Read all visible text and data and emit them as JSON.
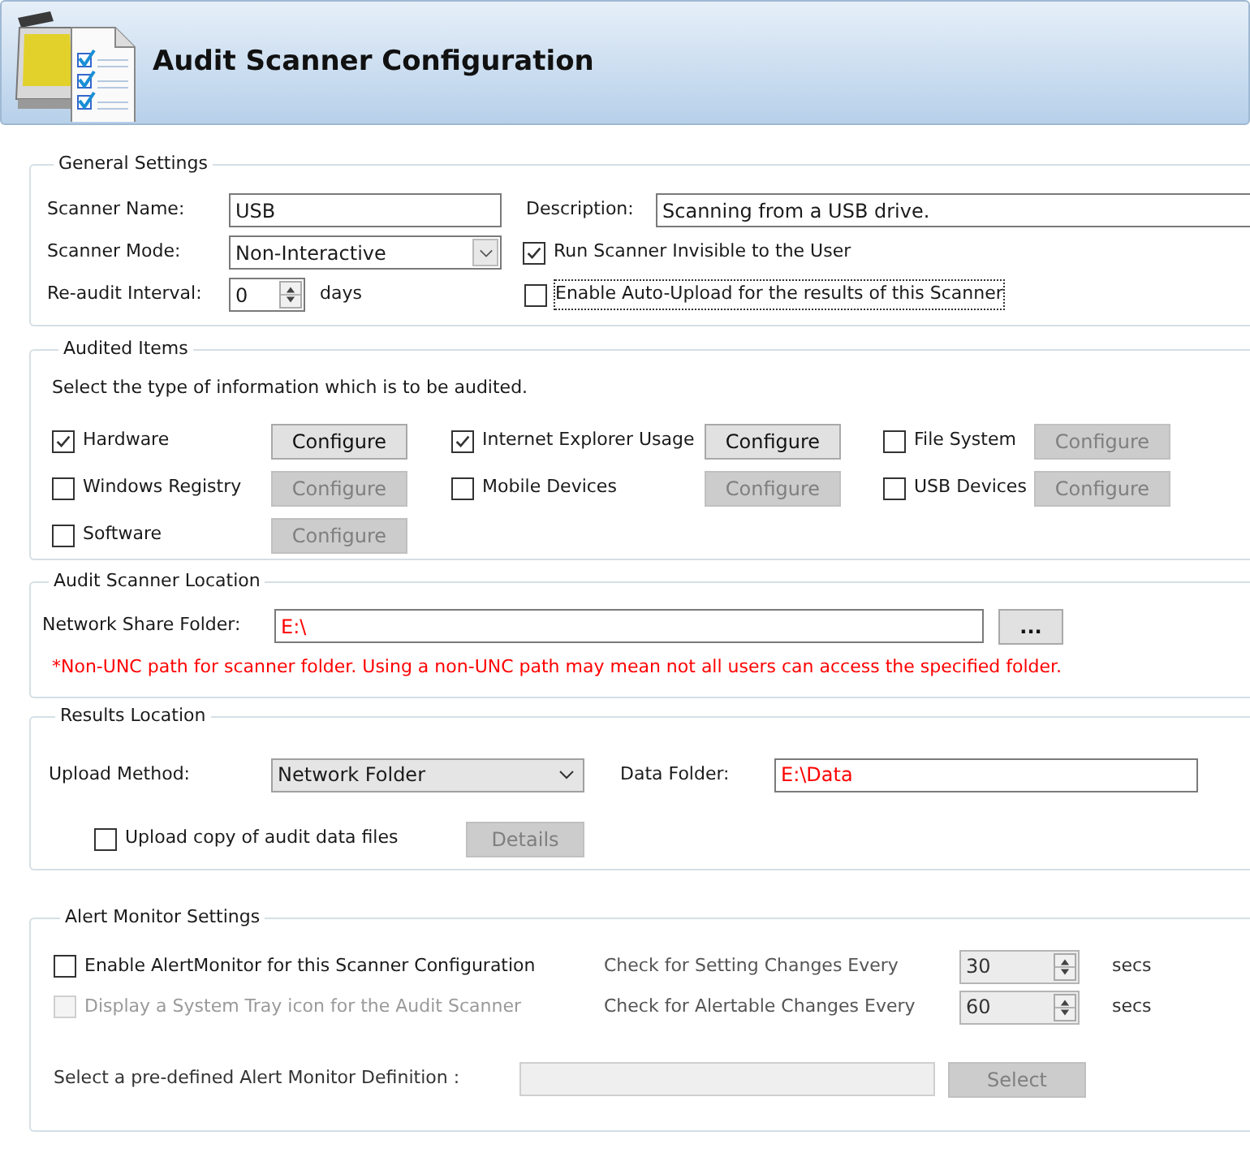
{
  "header": {
    "title": "Audit Scanner Configuration"
  },
  "general": {
    "legend": "General Settings",
    "scanner_name": {
      "label": "Scanner Name:",
      "value": "USB"
    },
    "description": {
      "label": "Description:",
      "value": "Scanning from a USB drive."
    },
    "scanner_mode": {
      "label": "Scanner Mode:",
      "value": "Non-Interactive"
    },
    "run_invisible": {
      "label": "Run Scanner Invisible to the User",
      "checked": true,
      "focused": false
    },
    "reaudit_interval": {
      "label": "Re-audit Interval:",
      "value": "0",
      "unit": "days"
    },
    "auto_upload": {
      "label": "Enable Auto-Upload for the results of this Scanner",
      "checked": false,
      "focused": true
    }
  },
  "audited_items": {
    "legend": "Audited Items",
    "instruction": "Select the type of information which is to be audited.",
    "items": [
      {
        "label": "Hardware",
        "checked": true,
        "button": {
          "label": "Configure",
          "disabled": false
        }
      },
      {
        "label": "Internet Explorer Usage",
        "checked": true,
        "button": {
          "label": "Configure",
          "disabled": false
        }
      },
      {
        "label": "File System",
        "checked": false,
        "button": {
          "label": "Configure",
          "disabled": true
        }
      },
      {
        "label": "Windows Registry",
        "checked": false,
        "button": {
          "label": "Configure",
          "disabled": true
        }
      },
      {
        "label": "Mobile Devices",
        "checked": false,
        "button": {
          "label": "Configure",
          "disabled": true
        }
      },
      {
        "label": "USB Devices",
        "checked": false,
        "button": {
          "label": "Configure",
          "disabled": true
        }
      },
      {
        "label": "Software",
        "checked": false,
        "button": {
          "label": "Configure",
          "disabled": true
        }
      }
    ]
  },
  "scanner_location": {
    "legend": "Audit Scanner Location",
    "label": "Network Share Folder:",
    "value": "E:\\",
    "browse_button": "...",
    "warning": "*Non-UNC path for scanner folder. Using a non-UNC path may mean not all users can access the specified folder."
  },
  "results_location": {
    "legend": "Results Location",
    "upload_method": {
      "label": "Upload Method:",
      "value": "Network Folder"
    },
    "data_folder": {
      "label": "Data Folder:",
      "value": "E:\\Data"
    },
    "upload_copy": {
      "label": "Upload copy of audit data files",
      "checked": false
    },
    "details_button": {
      "label": "Details",
      "disabled": true
    }
  },
  "alert_monitor": {
    "legend": "Alert Monitor Settings",
    "options": [
      {
        "label": "Enable AlertMonitor for this Scanner Configuration",
        "checked": false,
        "disabled": false
      },
      {
        "label": "Display a System Tray icon for the Audit Scanner",
        "checked": false,
        "disabled": true
      }
    ],
    "intervals": [
      {
        "label": "Check for Setting Changes Every",
        "value": "30",
        "unit": "secs",
        "disabled": true
      },
      {
        "label": "Check for Alertable Changes Every",
        "value": "60",
        "unit": "secs",
        "disabled": true
      }
    ],
    "definition": {
      "label": "Select a pre-defined Alert Monitor Definition :",
      "disabled": true
    },
    "select_button": {
      "label": "Select",
      "disabled": true
    }
  }
}
